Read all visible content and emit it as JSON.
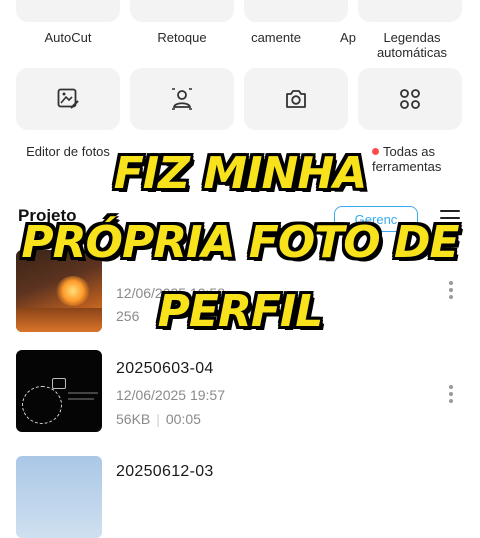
{
  "tools_row1": [
    {
      "label": "AutoCut"
    },
    {
      "label": "Retoque"
    },
    {
      "label": "camente"
    },
    {
      "label": "Ap"
    },
    {
      "label": "Legendas automáticas"
    }
  ],
  "tools_row2": [
    {
      "label": "Editor de fotos",
      "icon": "photo-edit-icon"
    },
    {
      "label": "",
      "icon": "person-cutout-icon"
    },
    {
      "label": "",
      "icon": "camera-icon"
    },
    {
      "label": "Todas as ferramentas",
      "icon": "grid-icon",
      "badge_color": "#ff4d4f"
    }
  ],
  "projects_section": {
    "title": "Projeto",
    "manage_label": "Gerenc"
  },
  "projects": [
    {
      "name": "",
      "date": "12/06/2025 19:58",
      "size": "256",
      "duration": ""
    },
    {
      "name": "20250603-04",
      "date": "12/06/2025 19:57",
      "size": "56KB",
      "duration": "00:05"
    },
    {
      "name": "20250612-03",
      "date": "",
      "size": "",
      "duration": ""
    }
  ],
  "overlay": {
    "line1": "FIZ MINHA",
    "line2": "PRÓPRIA FOTO DE",
    "line3": "PERFIL"
  },
  "colors": {
    "overlay_text": "#f7e21b",
    "accent": "#3aa9f0",
    "badge": "#ff4d4f"
  }
}
